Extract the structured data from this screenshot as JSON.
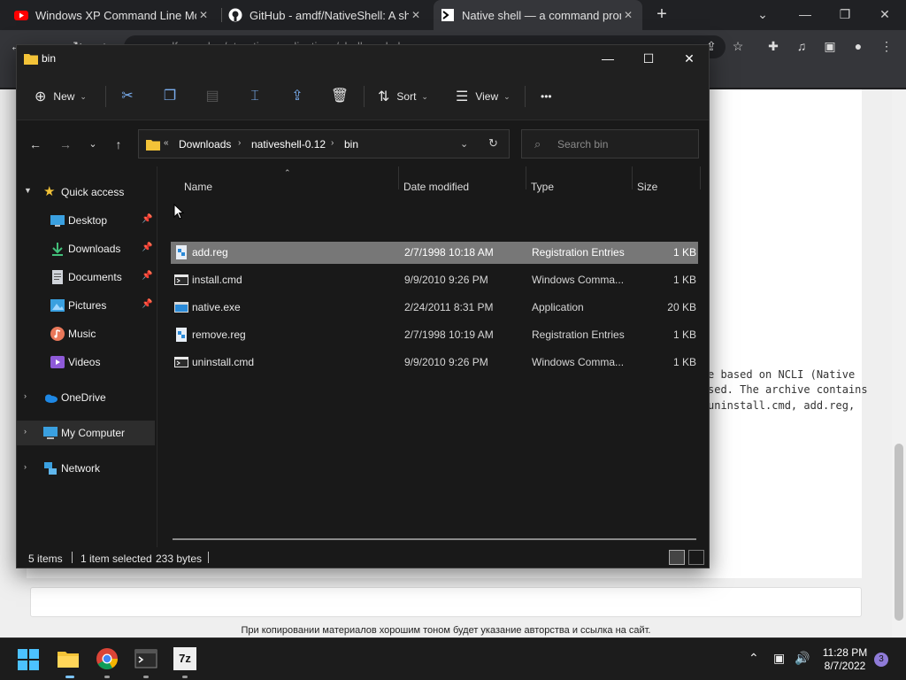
{
  "browser": {
    "tabs": [
      {
        "title": "Windows XP Command Line Moc",
        "close": "✕"
      },
      {
        "title": "GitHub - amdf/NativeShell: A she",
        "close": "✕"
      },
      {
        "title": "Native shell — a command prom",
        "close": "✕"
      }
    ],
    "new_tab": "+",
    "address": "amdf.narod.ru/nt-native-applications/shell-cmd.php",
    "page_text": [
      "e based on NCLI (Native",
      "sed. The archive contains",
      " uninstall.cmd, add.reg,"
    ],
    "footer": "При копировании материалов хорошим тоном будет указание авторства и ссылка на сайт."
  },
  "explorer": {
    "title": "bin",
    "commands": {
      "new": "New",
      "sort": "Sort",
      "view": "View",
      "more": "•••"
    },
    "breadcrumb": {
      "overflow": "«",
      "items": [
        "Downloads",
        "nativeshell-0.12",
        "bin"
      ]
    },
    "search_placeholder": "Search bin",
    "sidebar": {
      "quick_access": "Quick access",
      "items": [
        {
          "label": "Desktop",
          "icon": "desktop-icon",
          "pinned": true
        },
        {
          "label": "Downloads",
          "icon": "downloads-icon",
          "pinned": true
        },
        {
          "label": "Documents",
          "icon": "documents-icon",
          "pinned": true
        },
        {
          "label": "Pictures",
          "icon": "pictures-icon",
          "pinned": true
        },
        {
          "label": "Music",
          "icon": "music-icon",
          "pinned": false
        },
        {
          "label": "Videos",
          "icon": "videos-icon",
          "pinned": false
        }
      ],
      "onedrive": "OneDrive",
      "my_computer": "My Computer",
      "network": "Network"
    },
    "columns": {
      "name": "Name",
      "date": "Date modified",
      "type": "Type",
      "size": "Size"
    },
    "files": [
      {
        "name": "add.reg",
        "date": "2/7/1998 10:18 AM",
        "type": "Registration Entries",
        "size": "1 KB",
        "selected": true,
        "icon": "reg-file-icon"
      },
      {
        "name": "install.cmd",
        "date": "9/9/2010 9:26 PM",
        "type": "Windows Comma...",
        "size": "1 KB",
        "selected": false,
        "icon": "cmd-file-icon"
      },
      {
        "name": "native.exe",
        "date": "2/24/2011 8:31 PM",
        "type": "Application",
        "size": "20 KB",
        "selected": false,
        "icon": "exe-file-icon"
      },
      {
        "name": "remove.reg",
        "date": "2/7/1998 10:19 AM",
        "type": "Registration Entries",
        "size": "1 KB",
        "selected": false,
        "icon": "reg-file-icon"
      },
      {
        "name": "uninstall.cmd",
        "date": "9/9/2010 9:26 PM",
        "type": "Windows Comma...",
        "size": "1 KB",
        "selected": false,
        "icon": "cmd-file-icon"
      }
    ],
    "status": {
      "items": "5 items",
      "selected": "1 item selected",
      "size": "233 bytes"
    }
  },
  "taskbar": {
    "time": "11:28 PM",
    "date": "8/7/2022",
    "notifications": "3",
    "app_7z": "7z"
  }
}
